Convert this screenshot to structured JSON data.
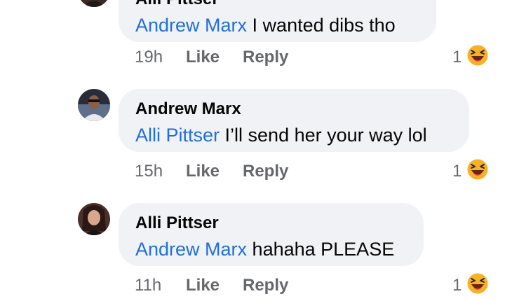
{
  "comments": [
    {
      "author": "Alli Pittser",
      "mention": "Andrew Marx",
      "text": " I wanted dibs tho",
      "time": "19h",
      "like_label": "Like",
      "reply_label": "Reply",
      "reaction_count": "1",
      "reaction_icon": "laughing-emoji-icon"
    },
    {
      "author": "Andrew Marx",
      "mention": "Alli Pittser",
      "text": " I’ll send her your way lol",
      "time": "15h",
      "like_label": "Like",
      "reply_label": "Reply",
      "reaction_count": "1",
      "reaction_icon": "laughing-emoji-icon"
    },
    {
      "author": "Alli Pittser",
      "mention": "Andrew Marx",
      "text": " hahaha PLEASE",
      "time": "11h",
      "like_label": "Like",
      "reply_label": "Reply",
      "reaction_count": "1",
      "reaction_icon": "laughing-emoji-icon"
    }
  ],
  "colors": {
    "mention": "#216fdb",
    "bubble": "#f0f2f5",
    "meta_text": "#65676b",
    "emoji_yellow": "#f7b125"
  }
}
